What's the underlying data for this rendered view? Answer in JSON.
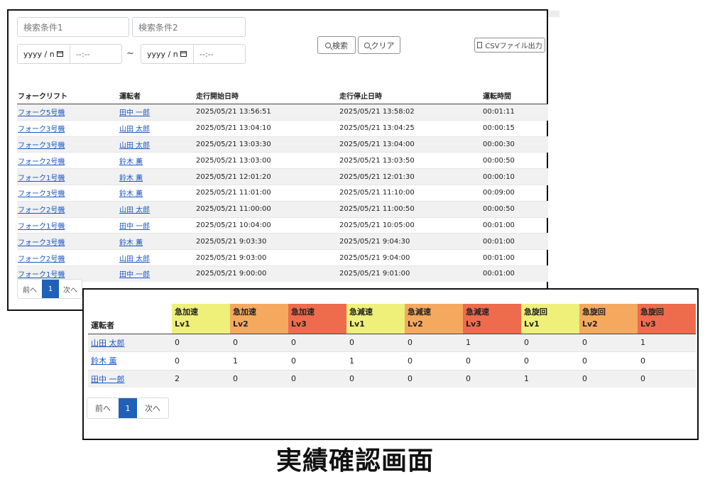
{
  "search": {
    "cond1_placeholder": "検索条件1",
    "cond2_placeholder": "検索条件2",
    "date_from": "yyyy / n",
    "time_from": "--:--",
    "tilde": "~",
    "date_to": "yyyy / n",
    "time_to": "--:--",
    "search_label": "検索",
    "clear_label": "クリア",
    "csv_label": "CSVファイル出力"
  },
  "colors": {
    "lv1": "#eef07a",
    "lv2": "#f5a95e",
    "lv3": "#ee6c4d",
    "link": "#1a56c4",
    "page_active": "#2060b8"
  },
  "log_table": {
    "headers": [
      "フォークリフト",
      "運転者",
      "走行開始日時",
      "走行停止日時",
      "運転時間"
    ],
    "rows": [
      [
        "フォーク5号機",
        "田中 一郎",
        "2025/05/21 13:56:51",
        "2025/05/21 13:58:02",
        "00:01:11"
      ],
      [
        "フォーク3号機",
        "山田 太郎",
        "2025/05/21 13:04:10",
        "2025/05/21 13:04:25",
        "00:00:15"
      ],
      [
        "フォーク3号機",
        "山田 太郎",
        "2025/05/21 13:03:30",
        "2025/05/21 13:04:00",
        "00:00:30"
      ],
      [
        "フォーク2号機",
        "鈴木 薫",
        "2025/05/21 13:03:00",
        "2025/05/21 13:03:50",
        "00:00:50"
      ],
      [
        "フォーク1号機",
        "鈴木 薫",
        "2025/05/21 12:01:20",
        "2025/05/21 12:01:30",
        "00:00:10"
      ],
      [
        "フォーク3号機",
        "鈴木 薫",
        "2025/05/21 11:01:00",
        "2025/05/21 11:10:00",
        "00:09:00"
      ],
      [
        "フォーク2号機",
        "山田 太郎",
        "2025/05/21 11:00:00",
        "2025/05/21 11:00:50",
        "00:00:50"
      ],
      [
        "フォーク1号機",
        "田中 一郎",
        "2025/05/21 10:04:00",
        "2025/05/21 10:05:00",
        "00:01:00"
      ],
      [
        "フォーク3号機",
        "鈴木 薫",
        "2025/05/21 9:03:30",
        "2025/05/21 9:04:30",
        "00:01:00"
      ],
      [
        "フォーク2号機",
        "山田 太郎",
        "2025/05/21 9:03:00",
        "2025/05/21 9:04:00",
        "00:01:00"
      ],
      [
        "フォーク1号機",
        "田中 一郎",
        "2025/05/21 9:00:00",
        "2025/05/21 9:01:00",
        "00:01:00"
      ]
    ]
  },
  "pager1": {
    "prev": "前へ",
    "page": "1",
    "next": "次へ"
  },
  "event_table": {
    "driver_header": "運転者",
    "columns": [
      {
        "name": "急加速",
        "level": "Lv1",
        "tier": "lv1"
      },
      {
        "name": "急加速",
        "level": "Lv2",
        "tier": "lv2"
      },
      {
        "name": "急加速",
        "level": "Lv3",
        "tier": "lv3"
      },
      {
        "name": "急減速",
        "level": "Lv1",
        "tier": "lv1"
      },
      {
        "name": "急減速",
        "level": "Lv2",
        "tier": "lv2"
      },
      {
        "name": "急減速",
        "level": "Lv3",
        "tier": "lv3"
      },
      {
        "name": "急旋回",
        "level": "Lv1",
        "tier": "lv1"
      },
      {
        "name": "急旋回",
        "level": "Lv2",
        "tier": "lv2"
      },
      {
        "name": "急旋回",
        "level": "Lv3",
        "tier": "lv3"
      }
    ],
    "rows": [
      {
        "driver": "山田 太郎",
        "values": [
          "0",
          "0",
          "0",
          "0",
          "0",
          "1",
          "0",
          "0",
          "1"
        ]
      },
      {
        "driver": "鈴木 薫",
        "values": [
          "0",
          "1",
          "0",
          "1",
          "0",
          "0",
          "0",
          "0",
          "0"
        ]
      },
      {
        "driver": "田中 一郎",
        "values": [
          "2",
          "0",
          "0",
          "0",
          "0",
          "0",
          "1",
          "0",
          "0"
        ]
      }
    ]
  },
  "pager2": {
    "prev": "前へ",
    "page": "1",
    "next": "次へ"
  },
  "caption": "実績確認画面"
}
